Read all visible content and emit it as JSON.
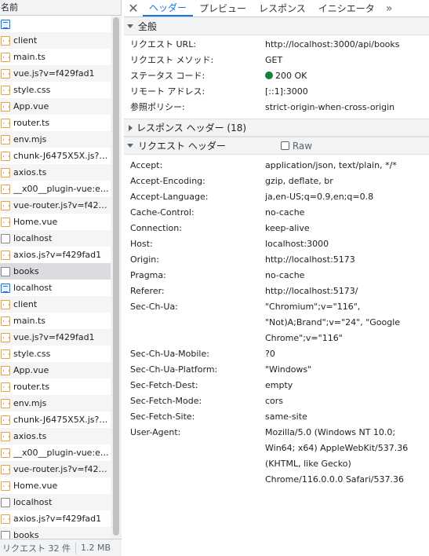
{
  "left": {
    "header": "名前",
    "items": [
      {
        "name": "",
        "icon": "doc"
      },
      {
        "name": "client",
        "icon": "script"
      },
      {
        "name": "main.ts",
        "icon": "script"
      },
      {
        "name": "vue.js?v=f429fad1",
        "icon": "script"
      },
      {
        "name": "style.css",
        "icon": "script"
      },
      {
        "name": "App.vue",
        "icon": "script"
      },
      {
        "name": "router.ts",
        "icon": "script"
      },
      {
        "name": "env.mjs",
        "icon": "script"
      },
      {
        "name": "chunk-J6475X5X.js?v...",
        "icon": "script"
      },
      {
        "name": "axios.ts",
        "icon": "script"
      },
      {
        "name": "__x00__plugin-vue:ex...",
        "icon": "script"
      },
      {
        "name": "vue-router.js?v=f429...",
        "icon": "script"
      },
      {
        "name": "Home.vue",
        "icon": "script"
      },
      {
        "name": "localhost",
        "icon": "fetch"
      },
      {
        "name": "axios.js?v=f429fad1",
        "icon": "script"
      },
      {
        "name": "books",
        "icon": "fetch",
        "selected": true
      },
      {
        "name": "localhost",
        "icon": "doc"
      },
      {
        "name": "client",
        "icon": "script"
      },
      {
        "name": "main.ts",
        "icon": "script"
      },
      {
        "name": "vue.js?v=f429fad1",
        "icon": "script"
      },
      {
        "name": "style.css",
        "icon": "script"
      },
      {
        "name": "App.vue",
        "icon": "script"
      },
      {
        "name": "router.ts",
        "icon": "script"
      },
      {
        "name": "env.mjs",
        "icon": "script"
      },
      {
        "name": "chunk-J6475X5X.js?v...",
        "icon": "script"
      },
      {
        "name": "axios.ts",
        "icon": "script"
      },
      {
        "name": "__x00__plugin-vue:ex...",
        "icon": "script"
      },
      {
        "name": "vue-router.js?v=f429...",
        "icon": "script"
      },
      {
        "name": "Home.vue",
        "icon": "script"
      },
      {
        "name": "localhost",
        "icon": "fetch"
      },
      {
        "name": "axios.js?v=f429fad1",
        "icon": "script"
      },
      {
        "name": "books",
        "icon": "fetch"
      }
    ],
    "status": {
      "requests": "リクエスト 32 件",
      "size": "1.2 MB"
    }
  },
  "tabs": {
    "close_icon": "✕",
    "items": [
      "ヘッダー",
      "プレビュー",
      "レスポンス",
      "イニシエータ"
    ],
    "more_icon": "»"
  },
  "general": {
    "title": "全般",
    "rows": [
      {
        "k": "リクエスト URL:",
        "v": "http://localhost:3000/api/books"
      },
      {
        "k": "リクエスト メソッド:",
        "v": "GET"
      },
      {
        "k": "ステータス コード:",
        "v": "200 OK",
        "status": true
      },
      {
        "k": "リモート アドレス:",
        "v": "[::1]:3000"
      },
      {
        "k": "参照ポリシー:",
        "v": "strict-origin-when-cross-origin"
      }
    ],
    "status_color": "#188038"
  },
  "response_headers": {
    "title": "レスポンス ヘッダー (18)"
  },
  "request_headers": {
    "title": "リクエスト ヘッダー",
    "raw_label": "Raw",
    "rows": [
      {
        "k": "Accept:",
        "v": "application/json, text/plain, */*"
      },
      {
        "k": "Accept-Encoding:",
        "v": "gzip, deflate, br"
      },
      {
        "k": "Accept-Language:",
        "v": "ja,en-US;q=0.9,en;q=0.8"
      },
      {
        "k": "Cache-Control:",
        "v": "no-cache"
      },
      {
        "k": "Connection:",
        "v": "keep-alive"
      },
      {
        "k": "Host:",
        "v": "localhost:3000"
      },
      {
        "k": "Origin:",
        "v": "http://localhost:5173"
      },
      {
        "k": "Pragma:",
        "v": "no-cache"
      },
      {
        "k": "Referer:",
        "v": "http://localhost:5173/"
      },
      {
        "k": "Sec-Ch-Ua:",
        "v": "\"Chromium\";v=\"116\", \"Not)A;Brand\";v=\"24\", \"Google Chrome\";v=\"116\""
      },
      {
        "k": "Sec-Ch-Ua-Mobile:",
        "v": "?0"
      },
      {
        "k": "Sec-Ch-Ua-Platform:",
        "v": "\"Windows\""
      },
      {
        "k": "Sec-Fetch-Dest:",
        "v": "empty"
      },
      {
        "k": "Sec-Fetch-Mode:",
        "v": "cors"
      },
      {
        "k": "Sec-Fetch-Site:",
        "v": "same-site"
      },
      {
        "k": "User-Agent:",
        "v": "Mozilla/5.0 (Windows NT 10.0; Win64; x64) AppleWebKit/537.36 (KHTML, like Gecko) Chrome/116.0.0.0 Safari/537.36"
      }
    ]
  },
  "colors": {
    "accent": "#1a73e8",
    "selected_row": "#dadce0"
  }
}
